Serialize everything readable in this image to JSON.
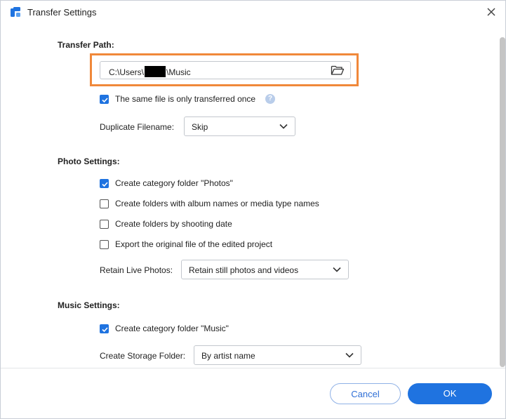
{
  "window": {
    "title": "Transfer Settings"
  },
  "transfer": {
    "section_title": "Transfer Path:",
    "path_prefix": "C:\\Users\\",
    "path_suffix": "\\Music",
    "same_file_once": {
      "label": "The same file is only transferred once",
      "checked": true
    },
    "help_glyph": "?",
    "duplicate_label": "Duplicate Filename:",
    "duplicate_value": "Skip"
  },
  "photo": {
    "section_title": "Photo Settings:",
    "options": [
      {
        "label": "Create category folder \"Photos\"",
        "checked": true
      },
      {
        "label": "Create folders with album names or media type names",
        "checked": false
      },
      {
        "label": "Create folders by shooting date",
        "checked": false
      },
      {
        "label": "Export the original file of the edited project",
        "checked": false
      }
    ],
    "live_label": "Retain Live Photos:",
    "live_value": "Retain still photos and videos"
  },
  "music": {
    "section_title": "Music Settings:",
    "category_folder": {
      "label": "Create category folder \"Music\"",
      "checked": true
    },
    "storage_label": "Create Storage Folder:",
    "storage_value": "By artist name"
  },
  "footer": {
    "cancel_label": "Cancel",
    "ok_label": "OK"
  },
  "colors": {
    "accent": "#1f73e0",
    "highlight": "#f0883a"
  },
  "icons": [
    "app-icon",
    "close-icon",
    "folder-open-icon",
    "help-icon",
    "chevron-down-icon",
    "checkmark-icon"
  ]
}
